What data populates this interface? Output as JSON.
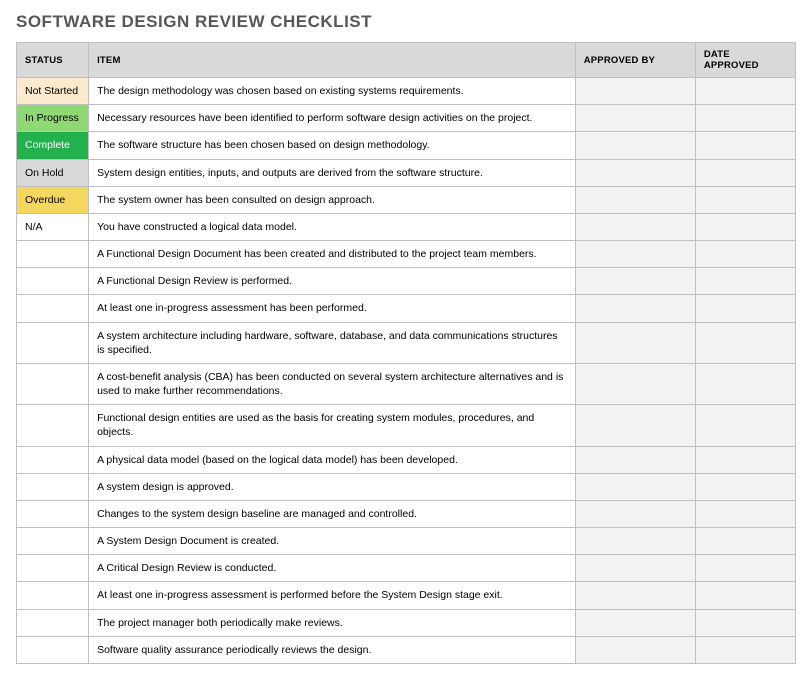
{
  "title": "SOFTWARE DESIGN REVIEW CHECKLIST",
  "headers": {
    "status": "STATUS",
    "item": "ITEM",
    "approved_by": "APPROVED BY",
    "date_approved": "DATE APPROVED"
  },
  "rows": [
    {
      "status": "Not Started",
      "status_key": "not-started",
      "item": "The design methodology was chosen based on existing systems requirements.",
      "approved_by": "",
      "date_approved": ""
    },
    {
      "status": "In Progress",
      "status_key": "in-progress",
      "item": "Necessary resources have been identified to perform software design activities on the project.",
      "approved_by": "",
      "date_approved": ""
    },
    {
      "status": "Complete",
      "status_key": "complete",
      "item": "The software structure has been chosen based on design methodology.",
      "approved_by": "",
      "date_approved": ""
    },
    {
      "status": "On Hold",
      "status_key": "on-hold",
      "item": "System design entities, inputs, and outputs are derived from the software structure.",
      "approved_by": "",
      "date_approved": ""
    },
    {
      "status": "Overdue",
      "status_key": "overdue",
      "item": "The system owner has been consulted on design approach.",
      "approved_by": "",
      "date_approved": ""
    },
    {
      "status": "N/A",
      "status_key": "",
      "item": "You have constructed a logical data model.",
      "approved_by": "",
      "date_approved": ""
    },
    {
      "status": "",
      "status_key": "",
      "item": "A Functional Design Document has been created and distributed to the project team members.",
      "approved_by": "",
      "date_approved": ""
    },
    {
      "status": "",
      "status_key": "",
      "item": "A Functional Design Review is performed.",
      "approved_by": "",
      "date_approved": ""
    },
    {
      "status": "",
      "status_key": "",
      "item": "At least one in-progress assessment has been performed.",
      "approved_by": "",
      "date_approved": ""
    },
    {
      "status": "",
      "status_key": "",
      "item": "A system architecture including hardware, software, database, and data communications structures is specified.",
      "approved_by": "",
      "date_approved": ""
    },
    {
      "status": "",
      "status_key": "",
      "item": "A cost-benefit analysis (CBA) has been conducted on several system architecture alternatives and is used to make further recommendations.",
      "approved_by": "",
      "date_approved": ""
    },
    {
      "status": "",
      "status_key": "",
      "item": "Functional design entities are used as the basis for creating system modules, procedures, and objects.",
      "approved_by": "",
      "date_approved": ""
    },
    {
      "status": "",
      "status_key": "",
      "item": "A physical data model (based on the logical data model) has been developed.",
      "approved_by": "",
      "date_approved": ""
    },
    {
      "status": "",
      "status_key": "",
      "item": "A system design is approved.",
      "approved_by": "",
      "date_approved": ""
    },
    {
      "status": "",
      "status_key": "",
      "item": "Changes to the system design baseline are managed and controlled.",
      "approved_by": "",
      "date_approved": ""
    },
    {
      "status": "",
      "status_key": "",
      "item": "A System Design Document is created.",
      "approved_by": "",
      "date_approved": ""
    },
    {
      "status": "",
      "status_key": "",
      "item": "A Critical Design Review is conducted.",
      "approved_by": "",
      "date_approved": ""
    },
    {
      "status": "",
      "status_key": "",
      "item": "At least one in-progress assessment is performed before the System Design stage exit.",
      "approved_by": "",
      "date_approved": ""
    },
    {
      "status": "",
      "status_key": "",
      "item": "The project manager both periodically make reviews.",
      "approved_by": "",
      "date_approved": ""
    },
    {
      "status": "",
      "status_key": "",
      "item": "Software quality assurance periodically reviews the design.",
      "approved_by": "",
      "date_approved": ""
    }
  ]
}
